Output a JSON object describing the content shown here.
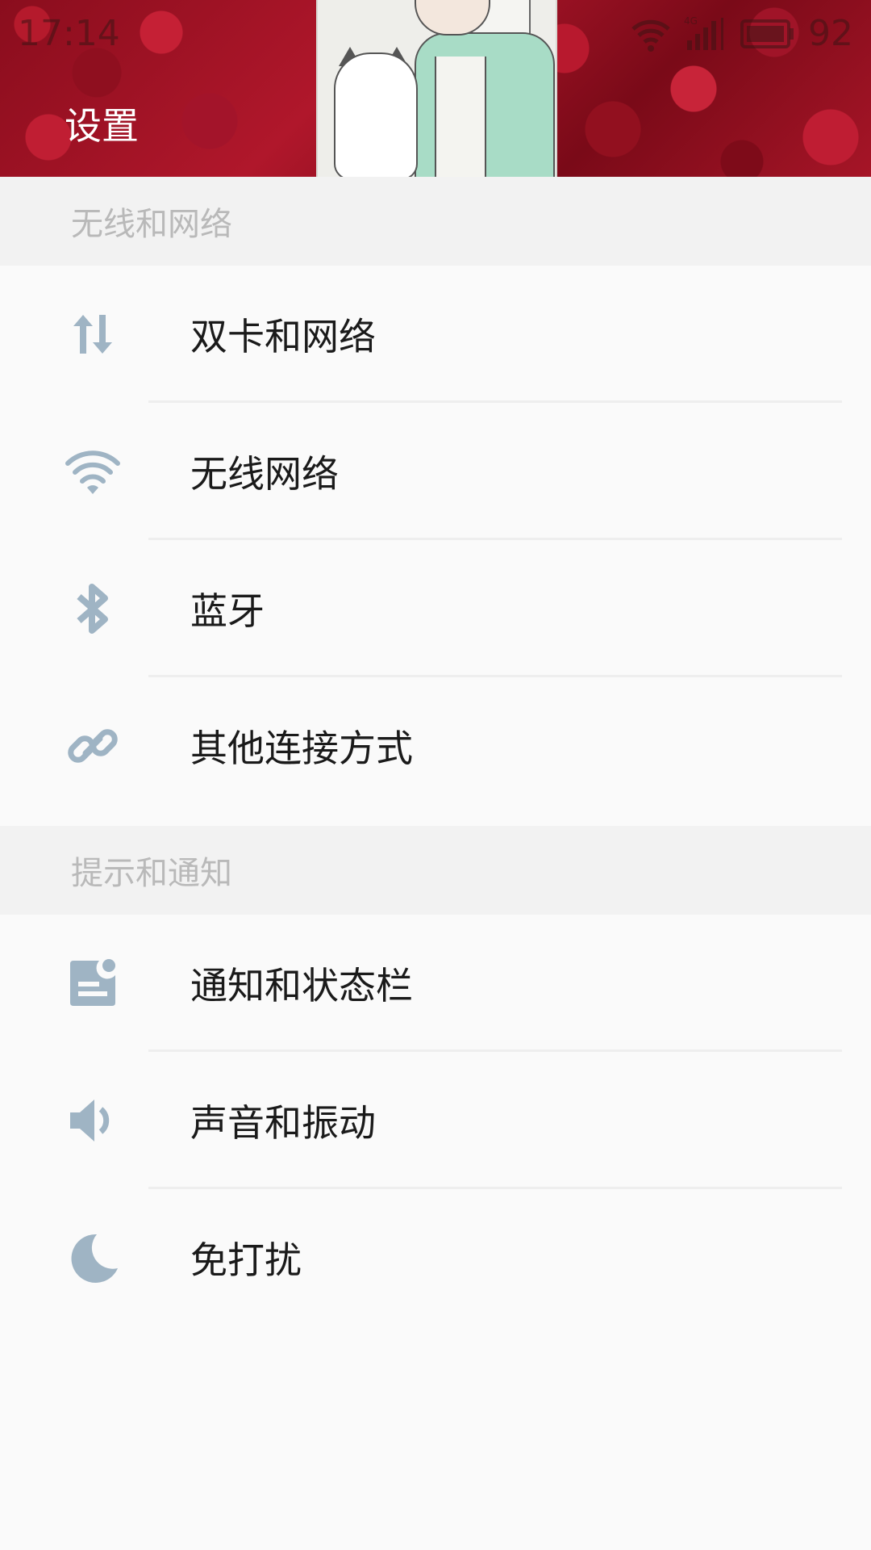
{
  "status_bar": {
    "time": "17:14",
    "battery": "92",
    "network_type": "4G"
  },
  "header": {
    "title": "设置"
  },
  "sections": [
    {
      "title": "无线和网络",
      "items": [
        {
          "label": "双卡和网络",
          "icon": "data-arrows-icon"
        },
        {
          "label": "无线网络",
          "icon": "wifi-icon"
        },
        {
          "label": "蓝牙",
          "icon": "bluetooth-icon"
        },
        {
          "label": "其他连接方式",
          "icon": "link-icon"
        }
      ]
    },
    {
      "title": "提示和通知",
      "items": [
        {
          "label": "通知和状态栏",
          "icon": "notification-icon"
        },
        {
          "label": "声音和振动",
          "icon": "speaker-icon"
        },
        {
          "label": "免打扰",
          "icon": "moon-icon"
        }
      ]
    }
  ],
  "colors": {
    "icon": "#9fb4c4",
    "section_bg": "#f2f2f2",
    "section_text": "#b9b9b9",
    "label_text": "#1a1a1a",
    "page_bg": "#fafafa"
  }
}
